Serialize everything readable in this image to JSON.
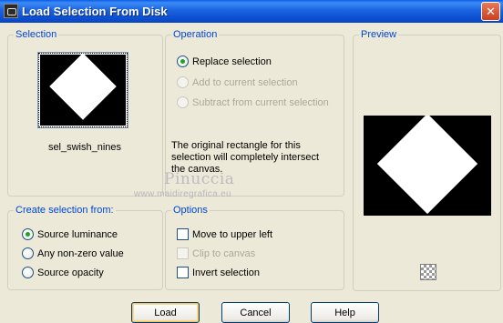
{
  "window": {
    "title": "Load Selection From Disk",
    "close_glyph": "✕"
  },
  "selection": {
    "label": "Selection",
    "item_name": "sel_swish_nines"
  },
  "operation": {
    "label": "Operation",
    "options": [
      {
        "label": "Replace selection",
        "selected": true,
        "enabled": true
      },
      {
        "label": "Add to current selection",
        "selected": false,
        "enabled": false
      },
      {
        "label": "Subtract from current selection",
        "selected": false,
        "enabled": false
      }
    ],
    "note": "The original rectangle for this selection will completely intersect the canvas."
  },
  "preview": {
    "label": "Preview"
  },
  "create_from": {
    "label": "Create selection from:",
    "options": [
      {
        "label": "Source luminance",
        "selected": true
      },
      {
        "label": "Any non-zero value",
        "selected": false
      },
      {
        "label": "Source opacity",
        "selected": false
      }
    ]
  },
  "options": {
    "label": "Options",
    "items": [
      {
        "label": "Move to upper left",
        "checked": false,
        "enabled": true
      },
      {
        "label": "Clip to canvas",
        "checked": false,
        "enabled": false
      },
      {
        "label": "Invert selection",
        "checked": false,
        "enabled": true
      }
    ]
  },
  "watermark": {
    "name": "Pinuccia",
    "url": "www.maidiregrafica.eu"
  },
  "buttons": {
    "load": "Load",
    "cancel": "Cancel",
    "help": "Help"
  },
  "colors": {
    "group_label": "#0046d5",
    "radio_selected": "#21a121",
    "dialog_bg": "#ece9d8"
  }
}
